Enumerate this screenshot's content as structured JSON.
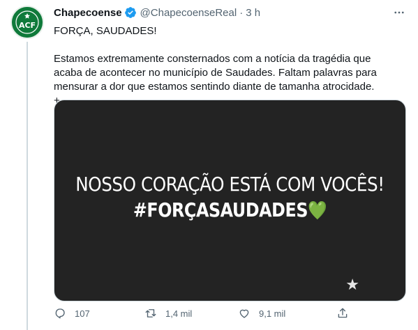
{
  "account": {
    "name": "Chapecoense",
    "handle": "@ChapecoenseReal",
    "separator": "·",
    "time": "3 h",
    "avatar_monogram": "ACF",
    "verified": true
  },
  "tweet": {
    "line1": "FORÇA, SAUDADES!",
    "paragraph": "Estamos extremamente consternados com a notícia da tragédia que acaba de acontecer no município de Saudades. Faltam palavras para mensurar a dor que estamos sentindo diante de tamanha atrocidade. +"
  },
  "media": {
    "line1": "NOSSO CORAÇÃO ESTÁ COM VOCÊS!",
    "line2": "#FORÇASAUDADES",
    "heart": "💚",
    "star": "★"
  },
  "actions": {
    "replies": "107",
    "retweets": "1,4 mil",
    "likes": "9,1 mil"
  },
  "colors": {
    "brand_green": "#0f7a3a",
    "verified_blue": "#1d9bf0",
    "heart_green": "#1fa84a",
    "media_bg": "#232323",
    "muted_text": "#536471"
  },
  "icons": {
    "reply": "reply-icon",
    "retweet": "retweet-icon",
    "like": "heart-outline-icon",
    "share": "share-icon",
    "more": "more-icon",
    "verified": "verified-badge-icon"
  }
}
